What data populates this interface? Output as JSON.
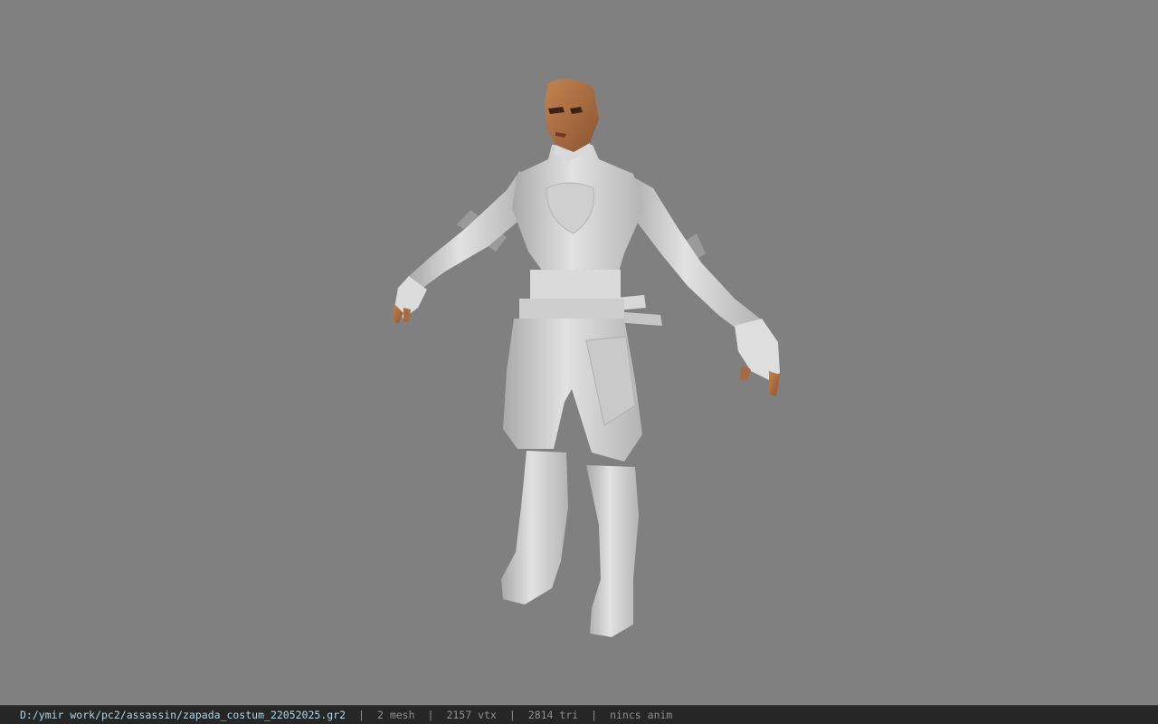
{
  "viewport": {
    "background": "#808080",
    "subject": "character-model"
  },
  "status_bar": {
    "file_path": "D:/ymir work/pc2/assassin/zapada_costum_22052025.gr2",
    "separator": "|",
    "mesh_count": "2 mesh",
    "vertex_count": "2157 vtx",
    "triangle_count": "2814 tri",
    "animation": "nincs anim",
    "path_color": "#a9d6e8"
  }
}
